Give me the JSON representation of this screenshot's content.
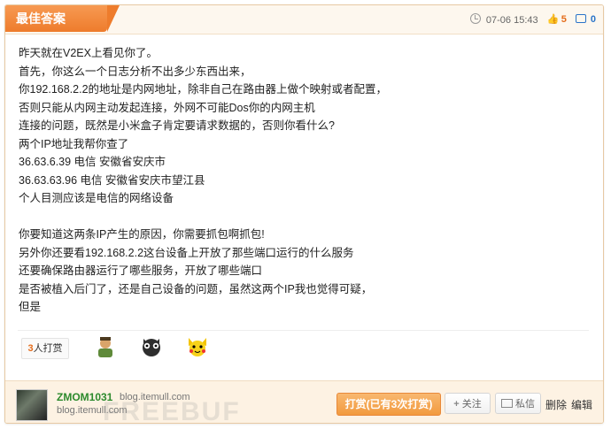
{
  "header": {
    "badge": "最佳答案",
    "time": "07-06 15:43",
    "likes": "5",
    "comments": "0"
  },
  "answer": {
    "lines": [
      "昨天就在V2EX上看见你了。",
      "首先，你这么一个日志分析不出多少东西出来，",
      "你192.168.2.2的地址是内网地址，除非自己在路由器上做个映射或者配置，",
      "否则只能从内网主动发起连接，外网不可能Dos你的内网主机",
      "连接的问题，既然是小米盒子肯定要请求数据的，否则你看什么?",
      "两个IP地址我帮你查了",
      "36.63.6.39 电信 安徽省安庆市",
      "36.63.63.96 电信 安徽省安庆市望江县",
      "个人目测应该是电信的网络设备",
      "",
      "你要知道这两条IP产生的原因，你需要抓包啊抓包!",
      "另外你还要看192.168.2.2这台设备上开放了那些端口运行的什么服务",
      "还要确保路由器运行了哪些服务，开放了哪些端口",
      "是否被植入后门了，还是自己设备的问题，虽然这两个IP我也觉得可疑，",
      "但是"
    ]
  },
  "reward": {
    "count": "3",
    "label": "人打赏"
  },
  "footer": {
    "username": "ZMOM1031",
    "blog": "blog.itemull.com",
    "blog2": "blog.itemull.com",
    "watermark": "FREEBUF",
    "reward_button": "打赏(已有3次打赏)",
    "follow_button": "关注",
    "message_button": "私信",
    "delete_link": "删除",
    "edit_link": "编辑"
  }
}
